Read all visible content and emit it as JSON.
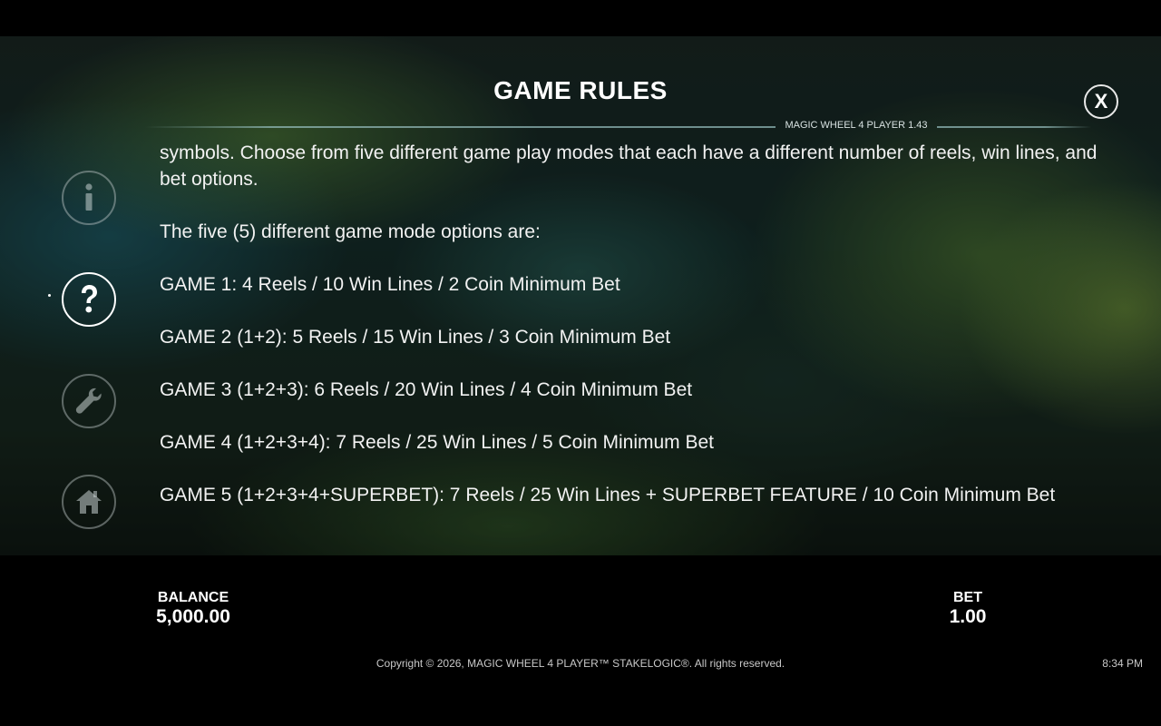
{
  "header": {
    "title": "GAME RULES",
    "version": "MAGIC WHEEL 4 PLAYER 1.43",
    "close_label": "X"
  },
  "nav": {
    "items": [
      {
        "name": "info",
        "icon": "info-icon"
      },
      {
        "name": "help",
        "icon": "question-icon",
        "active": true
      },
      {
        "name": "settings",
        "icon": "wrench-icon"
      },
      {
        "name": "home",
        "icon": "home-icon"
      }
    ]
  },
  "rules": {
    "intro_tail": "symbols. Choose from five different game play modes that each have a different number of reels, win lines, and bet options.",
    "modes_heading": "The five (5) different game mode options are:",
    "modes": [
      "GAME 1: 4 Reels / 10 Win Lines / 2 Coin Minimum Bet",
      "GAME 2 (1+2): 5 Reels / 15 Win Lines / 3 Coin Minimum Bet",
      "GAME 3 (1+2+3): 6 Reels / 20 Win Lines / 4 Coin Minimum Bet",
      "GAME 4 (1+2+3+4): 7 Reels / 25 Win Lines / 5 Coin Minimum Bet",
      "GAME 5 (1+2+3+4+SUPERBET): 7 Reels / 25 Win Lines + SUPERBET FEATURE / 10 Coin Minimum Bet"
    ]
  },
  "footer": {
    "balance_label": "BALANCE",
    "balance_value": "5,000.00",
    "bet_label": "BET",
    "bet_value": "1.00",
    "copyright": "Copyright © 2026, MAGIC WHEEL 4 PLAYER™ STAKELOGIC®. All rights reserved.",
    "clock": "8:34 PM"
  },
  "colors": {
    "text": "#ffffff",
    "ring_inactive": "#bec8c8",
    "background": "#000000"
  }
}
